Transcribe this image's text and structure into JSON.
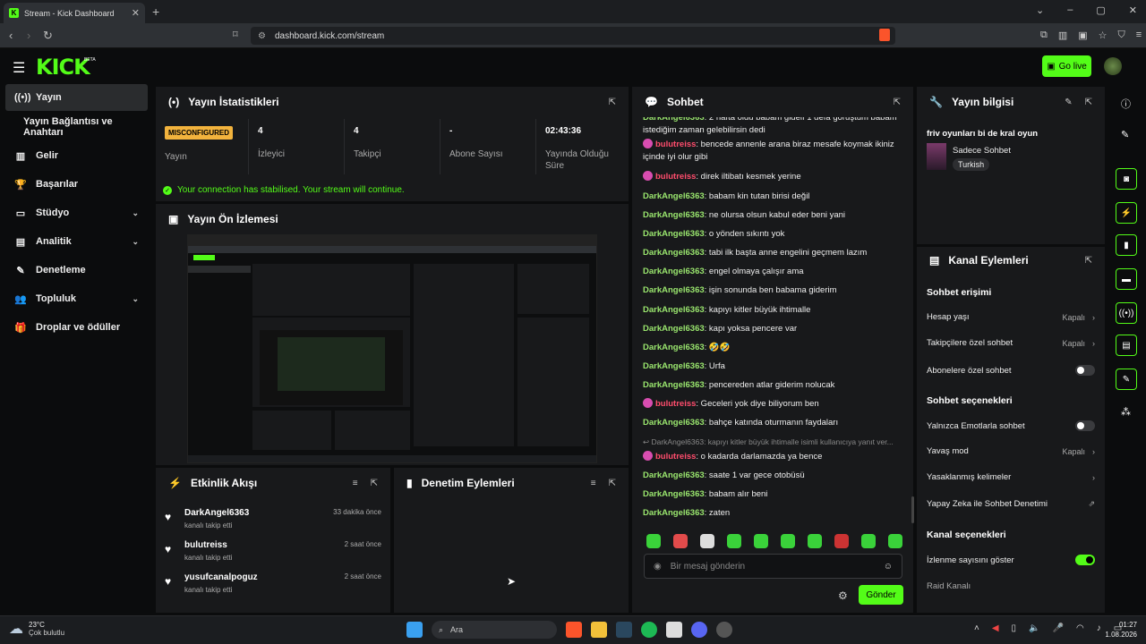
{
  "browser": {
    "tab_title": "Stream - Kick Dashboard",
    "tab_favicon": "K",
    "new_tab": "+",
    "url": "dashboard.kick.com/stream"
  },
  "header": {
    "logo": "KICK",
    "beta": "BETA",
    "go_live": "Go live"
  },
  "sidebar": {
    "items": [
      {
        "label": "Yayın"
      },
      {
        "label": "Yayın Bağlantısı ve Anahtarı"
      },
      {
        "label": "Gelir"
      },
      {
        "label": "Başarılar"
      },
      {
        "label": "Stüdyo"
      },
      {
        "label": "Analitik"
      },
      {
        "label": "Denetleme"
      },
      {
        "label": "Topluluk"
      },
      {
        "label": "Droplar ve ödüller"
      }
    ]
  },
  "stats": {
    "title": "Yayın İstatistikleri",
    "badge": "MISCONFIGURED",
    "badge_label": "Yayın",
    "cells": [
      {
        "value": "4",
        "label": "İzleyici"
      },
      {
        "value": "4",
        "label": "Takipçi"
      },
      {
        "value": "-",
        "label": "Abone Sayısı"
      },
      {
        "value": "02:43:36",
        "label": "Yayında Olduğu Süre"
      }
    ],
    "connection": "Your connection has stabilised. Your stream will continue."
  },
  "preview": {
    "title": "Yayın Ön İzlemesi"
  },
  "activity": {
    "title": "Etkinlik Akışı",
    "rows": [
      {
        "name": "DarkAngel6363",
        "sub": "kanalı takip etti",
        "time": "33 dakika önce"
      },
      {
        "name": "bulutreiss",
        "sub": "kanalı takip etti",
        "time": "2 saat önce"
      },
      {
        "name": "yusufcanalpoguz",
        "sub": "kanalı takip etti",
        "time": "2 saat önce"
      }
    ]
  },
  "moderation": {
    "title": "Denetim Eylemleri"
  },
  "chat": {
    "title": "Sohbet",
    "messages": [
      {
        "user": "DarkAngel6363",
        "text": ": 2 hafta oldu babam gidelı 1 defa goruştum babam istediğim zaman gelebilirsin dedi",
        "badge": false
      },
      {
        "user": "bulutreiss",
        "text": ": bencede annenle arana biraz mesafe koymak ikiniz içinde iyi olur gibi",
        "badge": true
      },
      {
        "user": "bulutreiss",
        "text": ": direk iltibatı kesmek yerine",
        "badge": true
      },
      {
        "user": "DarkAngel6363",
        "text": ": babam kin tutan birisi değil",
        "badge": false
      },
      {
        "user": "DarkAngel6363",
        "text": ": ne olursa olsun kabul eder beni yani",
        "badge": false
      },
      {
        "user": "DarkAngel6363",
        "text": ": o yönden sıkıntı yok",
        "badge": false
      },
      {
        "user": "DarkAngel6363",
        "text": ": tabi ilk başta anne engelini geçmem lazım",
        "badge": false
      },
      {
        "user": "DarkAngel6363",
        "text": ": engel olmaya çalışır ama",
        "badge": false
      },
      {
        "user": "DarkAngel6363",
        "text": ": işin sonunda ben babama giderim",
        "badge": false
      },
      {
        "user": "DarkAngel6363",
        "text": ": kapıyı kitler büyük ihtimalle",
        "badge": false
      },
      {
        "user": "DarkAngel6363",
        "text": ": kapı yoksa pencere var",
        "badge": false
      },
      {
        "user": "DarkAngel6363",
        "text": ": 🤣🤣",
        "badge": false
      },
      {
        "user": "DarkAngel6363",
        "text": ": Urfa",
        "badge": false
      },
      {
        "user": "DarkAngel6363",
        "text": ": pencereden atlar giderim nolucak",
        "badge": false
      },
      {
        "user": "bulutreiss",
        "text": ": Geceleri yok diye biliyorum ben",
        "badge": true
      },
      {
        "user": "DarkAngel6363",
        "text": ": bahçe katında oturmanın faydaları",
        "badge": false
      },
      {
        "reply": "↩ DarkAngel6363: kapıyı kitler büyük ihtimalle isimli kullanıcıya yanıt ver..."
      },
      {
        "user": "bulutreiss",
        "text": ": o kadarda darlamazda ya bence",
        "badge": true
      },
      {
        "user": "DarkAngel6363",
        "text": ": saate 1 var gece otobüsü",
        "badge": false
      },
      {
        "user": "DarkAngel6363",
        "text": ": babam alır beni",
        "badge": false
      },
      {
        "user": "DarkAngel6363",
        "text": ": zaten",
        "badge": false
      }
    ],
    "input_placeholder": "Bir mesaj gönderin",
    "send": "Gönder"
  },
  "info": {
    "title": "Yayın bilgisi",
    "stream_title": "friv oyunları bi de kral oyun",
    "category": "Sadece Sohbet",
    "tag": "Turkish"
  },
  "channel": {
    "title": "Kanal Eylemleri",
    "sec1": "Sohbet erişimi",
    "hesap": "Hesap yaşı",
    "takip": "Takipçilere özel sohbet",
    "abone": "Abonelere özel sohbet",
    "sec2": "Sohbet seçenekleri",
    "emote": "Yalnızca Emotlarla sohbet",
    "yavas": "Yavaş mod",
    "yasak": "Yasaklanmış kelimeler",
    "ai": "Yapay Zeka ile Sohbet Denetimi",
    "sec3": "Kanal seçenekleri",
    "izlenme": "İzlenme sayısını göster",
    "raid": "Raid Kanalı",
    "off": "Kapalı"
  },
  "taskbar": {
    "temp": "23°C",
    "weather": "Çok bulutlu",
    "search": "Ara",
    "time": "01:27",
    "date": "1.08.2026"
  },
  "colors": {
    "accent": "#53fc18",
    "badge": "#f2b33d",
    "mod_user": "#9ae66e",
    "other_user": "#ff4d6d"
  }
}
